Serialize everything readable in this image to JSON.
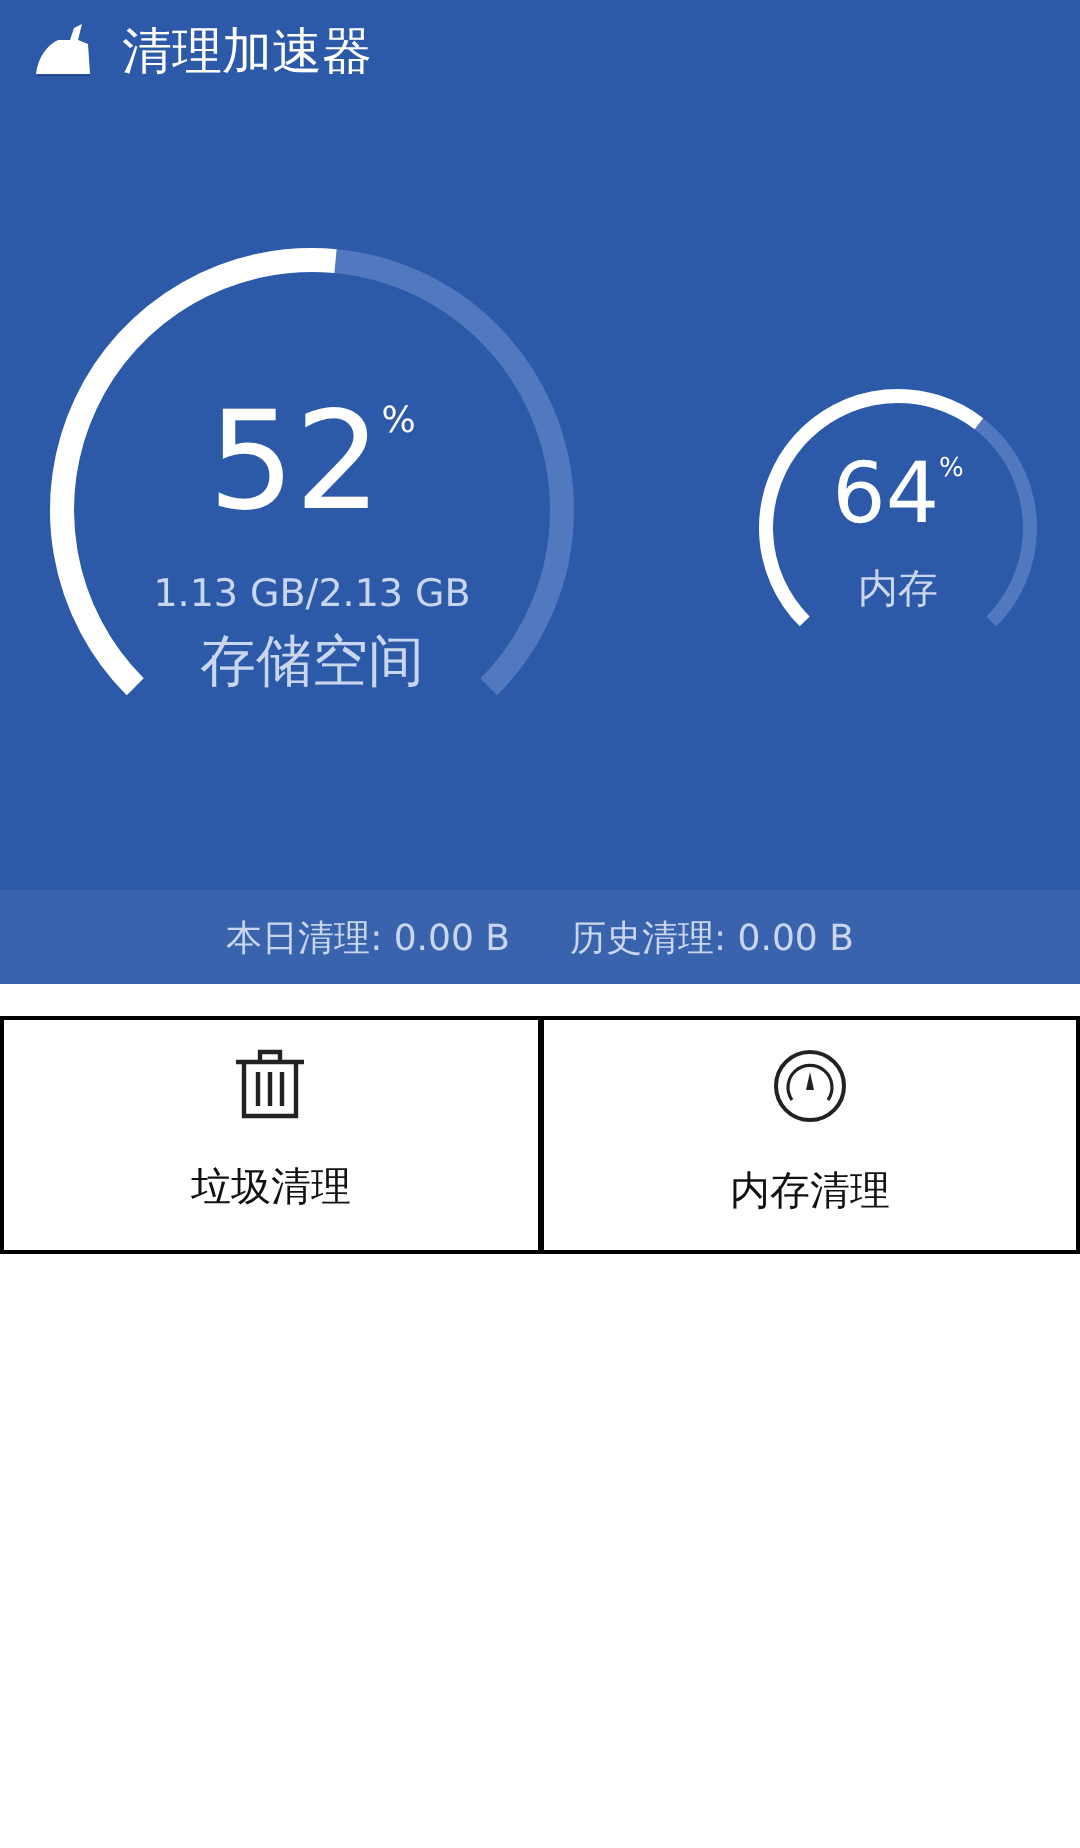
{
  "header": {
    "title": "清理加速器"
  },
  "gauges": [
    {
      "kind": "large",
      "value": "52",
      "unit": "%",
      "detail": "1.13 GB/2.13 GB",
      "label": "存储空间"
    },
    {
      "kind": "small",
      "value": "64",
      "unit": "%",
      "label": "内存"
    }
  ],
  "stats": [
    "本日清理: 0.00 B",
    "历史清理: 0.00 B"
  ],
  "actions": [
    {
      "kind": "trash",
      "label": "垃圾清理"
    },
    {
      "kind": "gauge",
      "label": "内存清理"
    }
  ]
}
